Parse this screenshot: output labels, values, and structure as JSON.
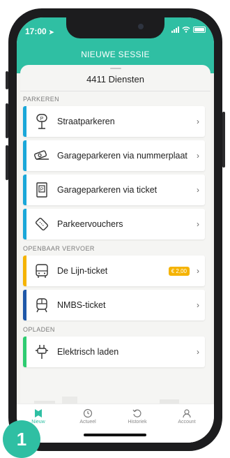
{
  "status": {
    "time": "17:00"
  },
  "header": {
    "title": "NIEUWE SESSIE"
  },
  "sheet": {
    "title": "4411 Diensten"
  },
  "sections": [
    {
      "label": "PARKEREN"
    },
    {
      "label": "OPENBAAR VERVOER"
    },
    {
      "label": "OPLADEN"
    }
  ],
  "items": [
    {
      "label": "Straatparkeren",
      "icon": "parking-meter-icon",
      "color": "#1aa7d9"
    },
    {
      "label": "Garageparkeren via nummerplaat",
      "icon": "camera-icon",
      "color": "#1aa7d9"
    },
    {
      "label": "Garageparkeren via ticket",
      "icon": "parking-ticket-icon",
      "color": "#1aa7d9"
    },
    {
      "label": "Parkeervouchers",
      "icon": "voucher-icon",
      "color": "#1aa7d9"
    },
    {
      "label": "De Lijn-ticket",
      "icon": "bus-icon",
      "color": "#f5b301",
      "badge": "€ 2,00"
    },
    {
      "label": "NMBS-ticket",
      "icon": "train-icon",
      "color": "#1e57a8"
    },
    {
      "label": "Elektrisch laden",
      "icon": "plug-icon",
      "color": "#2ecc71"
    }
  ],
  "tabs": [
    {
      "label": "Nieuw",
      "icon": "new-session-icon",
      "active": true
    },
    {
      "label": "Actueel",
      "icon": "clock-icon"
    },
    {
      "label": "Historiek",
      "icon": "history-icon"
    },
    {
      "label": "Account",
      "icon": "account-icon"
    }
  ],
  "step_marker": "1",
  "colors": {
    "brand": "#2fbfa3",
    "badge": "#f5b301"
  }
}
